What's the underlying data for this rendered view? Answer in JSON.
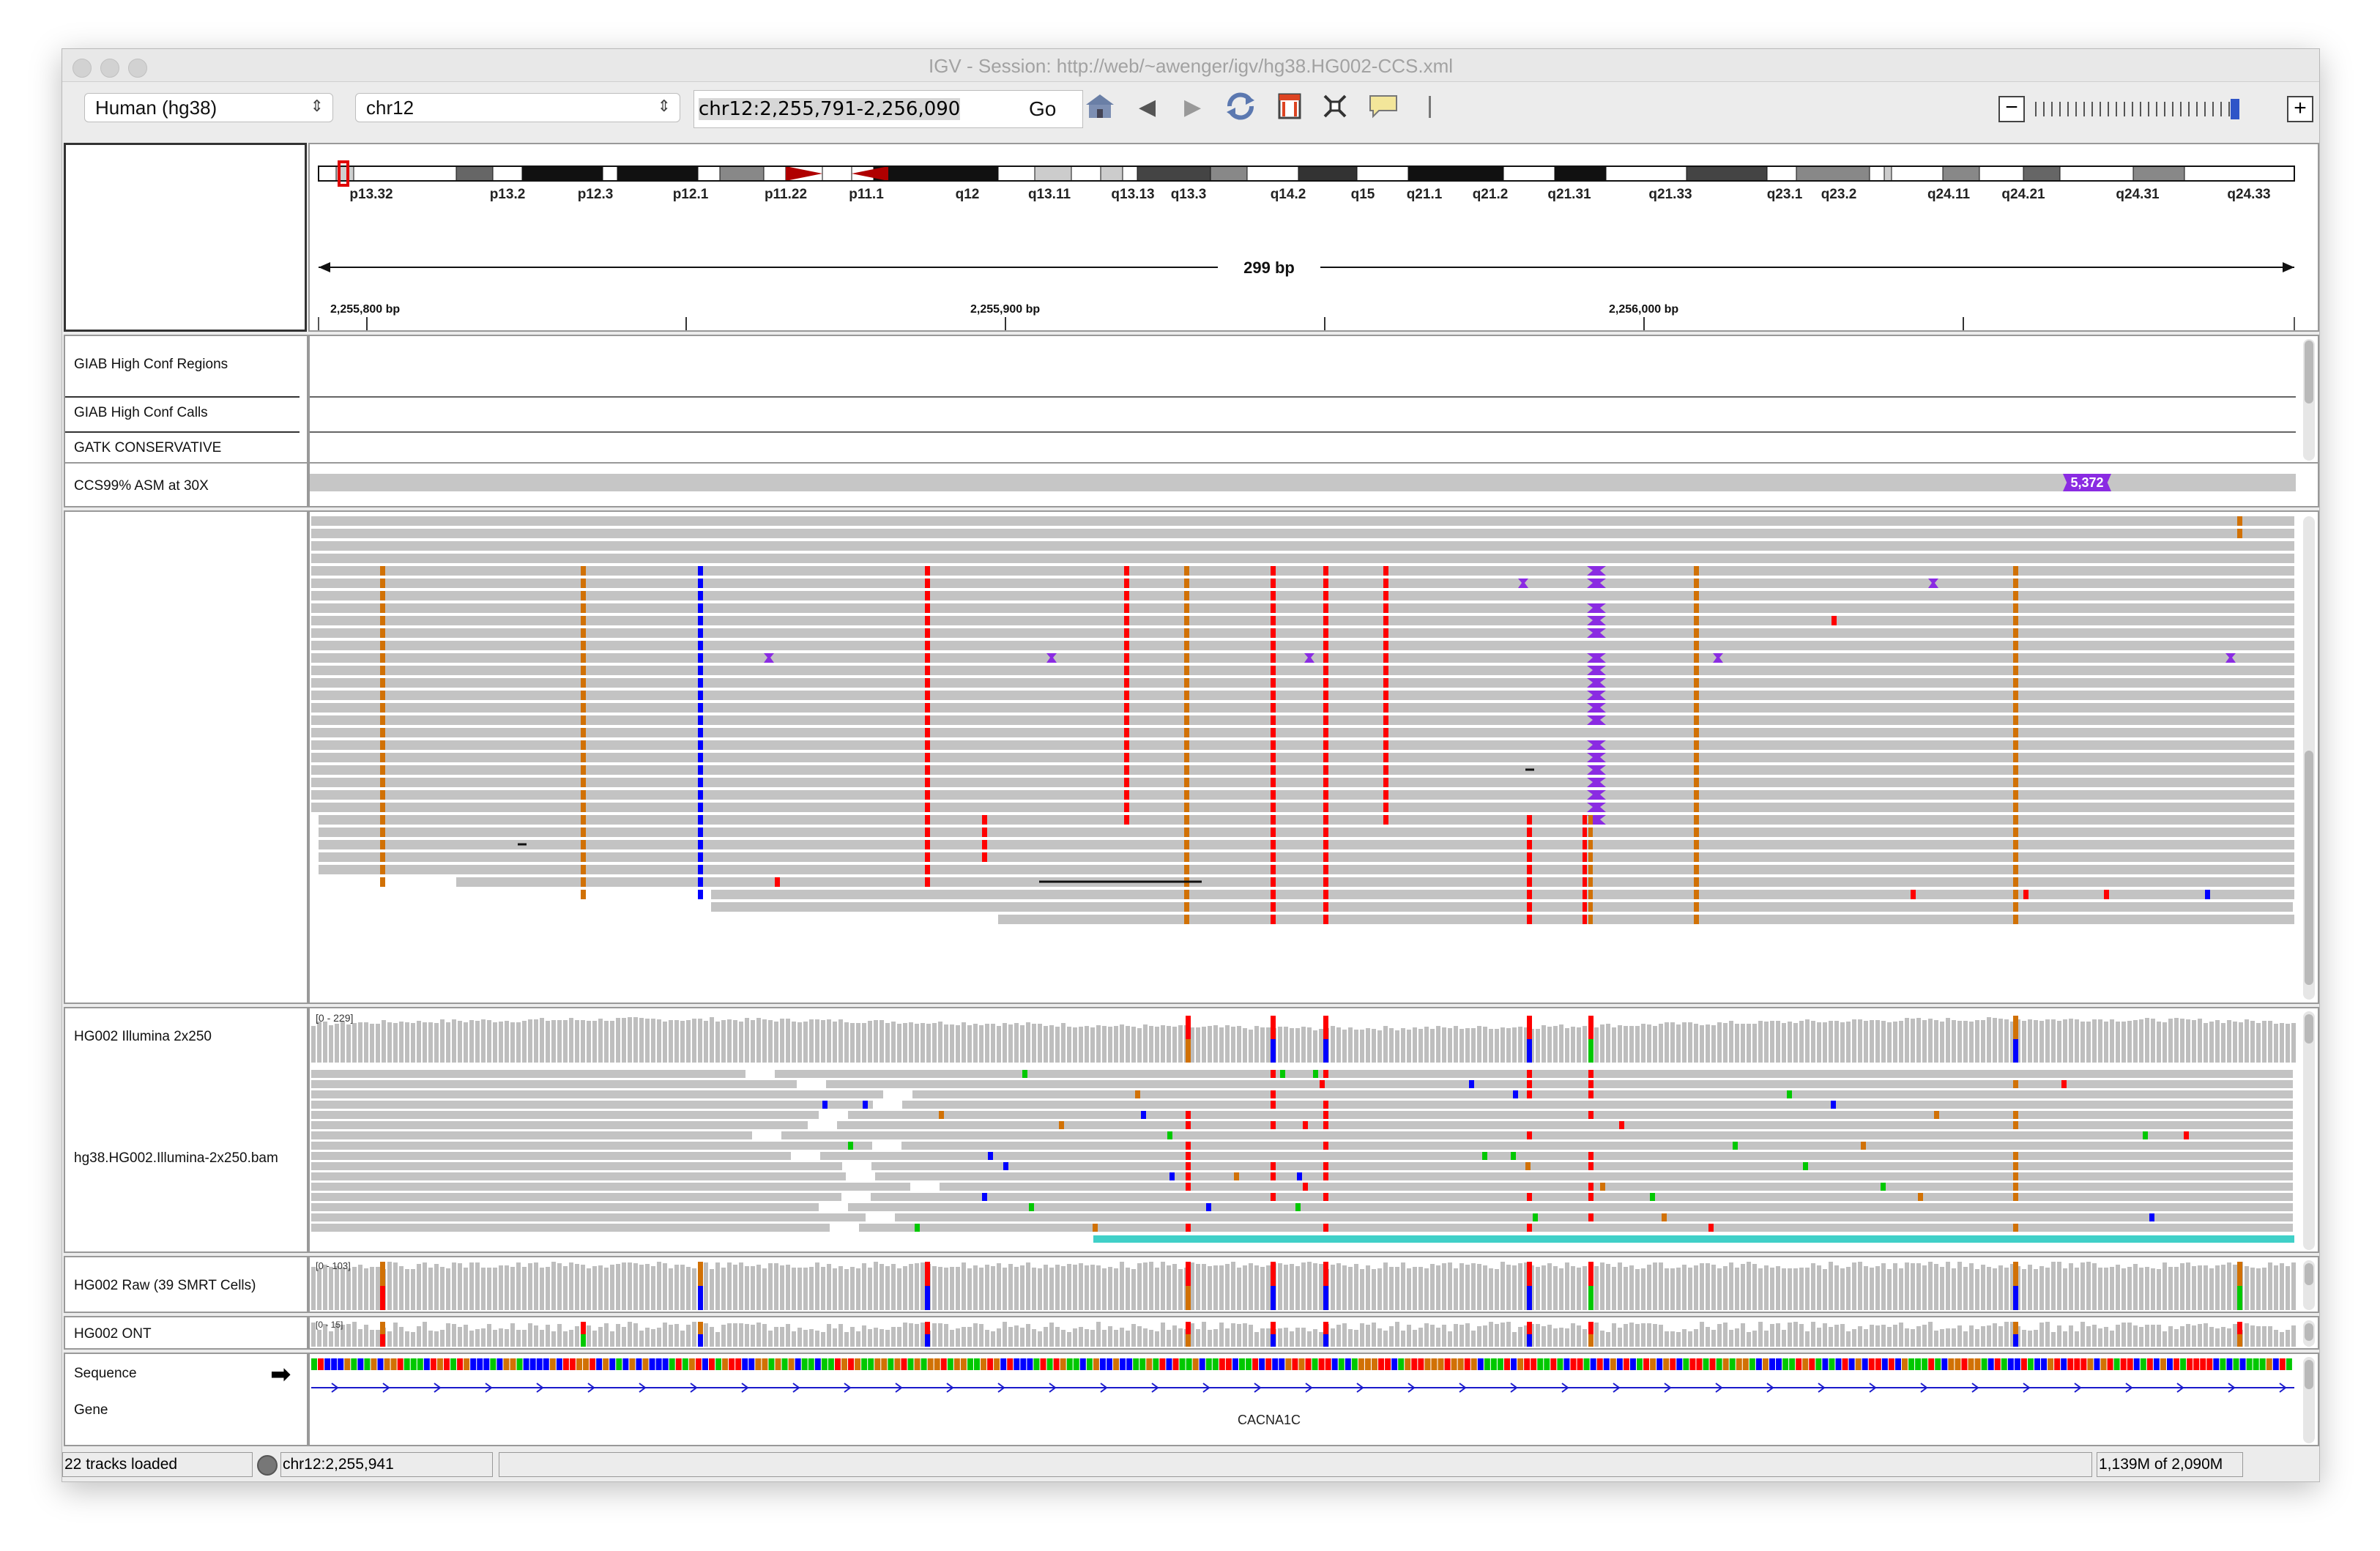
{
  "window": {
    "title": "IGV - Session: http://web/~awenger/igv/hg38.HG002-CCS.xml"
  },
  "toolbar": {
    "genome": "Human (hg38)",
    "chromosome": "chr12",
    "locus": "chr12:2,255,791-2,256,090",
    "go_label": "Go",
    "icons": [
      "home-icon",
      "back-icon",
      "forward-icon",
      "refresh-icon",
      "region-icon",
      "fit-icon",
      "popup-icon",
      "zoom-out-icon",
      "zoom-in-icon"
    ]
  },
  "ideogram": {
    "bands": [
      "p13.32",
      "p13.2",
      "p12.3",
      "p12.1",
      "p11.22",
      "p11.1",
      "q12",
      "q13.11",
      "q13.13",
      "q13.3",
      "q14.2",
      "q15",
      "q21.1",
      "q21.2",
      "q21.31",
      "q21.33",
      "q23.1",
      "q23.2",
      "q24.11",
      "q24.21",
      "q24.31",
      "q24.33"
    ]
  },
  "ruler": {
    "span": "299 bp",
    "ticks": [
      "2,255,800 bp",
      "2,255,900 bp",
      "2,256,000 bp"
    ]
  },
  "tracks": {
    "giab_regions": "GIAB High Conf Regions",
    "giab_calls": "GIAB High Conf Calls",
    "gatk": "GATK CONSERVATIVE",
    "ccs": "CCS99% ASM at 30X",
    "ccs_badge": "5,372",
    "illumina_cov": "HG002 Illumina 2x250",
    "illumina_range": "[0 - 229]",
    "illumina_bam": "hg38.HG002.Illumina-2x250.bam",
    "raw": "HG002 Raw (39 SMRT Cells)",
    "raw_range": "[0 - 103]",
    "ont": "HG002 ONT",
    "ont_range": "[0 - 15]",
    "sequence": "Sequence",
    "gene": "Gene",
    "gene_name": "CACNA1C"
  },
  "status": {
    "loaded": "22 tracks loaded",
    "position": "chr12:2,255,941",
    "memory": "1,139M of 2,090M"
  },
  "colors": {
    "A": "#00c800",
    "C": "#0000ff",
    "G": "#d17105",
    "T": "#ff0000",
    "insertion": "#8a2be2",
    "read": "#c3c3c3",
    "coverage": "#bebebe"
  }
}
